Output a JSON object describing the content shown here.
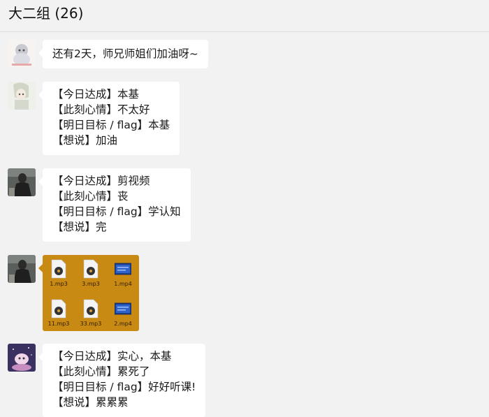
{
  "header": {
    "title": "大二组 (26)"
  },
  "messages": [
    {
      "type": "text",
      "lines": [
        "还有2天，师兄师姐们加油呀~"
      ]
    },
    {
      "type": "text",
      "lines": [
        "【今日达成】本基",
        "【此刻心情】不太好",
        "【明日目标 / flag】本基",
        "【想说】加油"
      ]
    },
    {
      "type": "text",
      "lines": [
        "【今日达成】剪视频",
        "【此刻心情】丧",
        "【明日目标 / flag】学认知",
        "【想说】完"
      ]
    },
    {
      "type": "files",
      "files": [
        {
          "name": "1.mp3",
          "icon": "audio-file-icon"
        },
        {
          "name": "3.mp3",
          "icon": "audio-file-icon"
        },
        {
          "name": "1.mp4",
          "icon": "video-file-icon"
        },
        {
          "name": "11.mp3",
          "icon": "audio-file-icon"
        },
        {
          "name": "33.mp3",
          "icon": "audio-file-icon"
        },
        {
          "name": "2.mp4",
          "icon": "video-file-icon"
        }
      ]
    },
    {
      "type": "text",
      "lines": [
        "【今日达成】实心，本基",
        "【此刻心情】累死了",
        "【明日目标 / flag】好好听课!",
        "【想说】累累累"
      ]
    }
  ],
  "colors": {
    "background": "#f2f2f2",
    "bubble": "#ffffff",
    "file_bubble": "#c98a14"
  }
}
